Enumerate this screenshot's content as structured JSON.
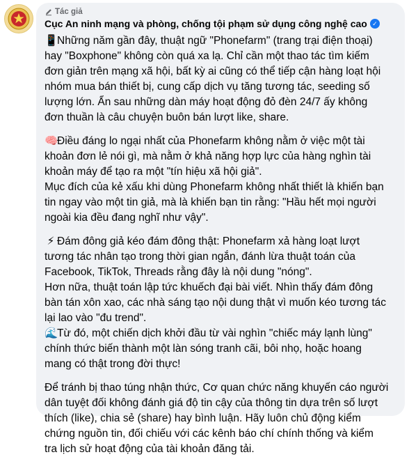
{
  "author_tag": "Tác giả",
  "author_name": "Cục An ninh mạng và phòng, chống tội phạm sử dụng công nghệ cao",
  "paragraphs": [
    {
      "emoji": "📱",
      "text": "Những năm gần đây, thuật ngữ \"Phonefarm\" (trang trại điện thoại)\nhay \"Boxphone\" không còn quá xa lạ. Chỉ cần một thao tác tìm kiếm\nđơn giản trên mạng xã hội, bất kỳ ai cũng có thể tiếp cận hàng loạt hội\nnhóm mua bán thiết bị, cung cấp dịch vụ tăng tương tác, seeding số\nlượng lớn. Ẩn sau những dàn máy hoạt động đỏ đèn 24/7 ấy không\nđơn thuần là câu chuyện buôn bán lượt like, share."
    },
    {
      "emoji": "🧠",
      "text": "Điều đáng lo ngại nhất của Phonefarm không nằm ở việc một tài\nkhoản đơn lẻ nói gì, mà nằm ở khả năng hợp lực của hàng nghìn tài\nkhoản máy để tạo ra một \"tín hiệu xã hội giả\".\nMục đích của kẻ xấu khi dùng Phonefarm không nhất thiết là khiến bạn\ntin ngay vào một tin giả, mà là khiến bạn tin rằng: \"Hầu hết mọi người\nngoài kia đều đang nghĩ như vậy\"."
    },
    {
      "emoji": "⚡",
      "text": "Đám đông giả kéo đám đông thật: Phonefarm xả hàng loạt lượt\ntương tác nhân tạo trong thời gian ngắn, đánh lừa thuật toán của\nFacebook, TikTok, Threads rằng đây là nội dung \"nóng\".\nHơn nữa, thuật toán lập tức khuếch đại bài viết. Nhìn thấy đám đông\nbàn tán xôn xao, các nhà sáng tạo nội dung thật vì muốn kéo tương tác\nlại lao vào \"đu trend\"."
    },
    {
      "emoji": "🌊",
      "text": "Từ đó, một chiến dịch khởi đầu từ vài nghìn \"chiếc máy lạnh lùng\"\nchính thức biến thành một làn sóng tranh cãi, bôi nhọ, hoặc hoang\nmang có thật trong đời thực!"
    },
    {
      "emoji": "",
      "text": "Để tránh bị thao túng nhận thức, Cơ quan chức năng khuyến cáo người\ndân tuyệt đối không đánh giá độ tin cậy của thông tin dựa trên số lượt\nthích (like), chia sẻ (share) hay bình luận. Hãy luôn chủ động kiểm\nchứng nguồn tin, đối chiếu với các kênh báo chí chính thống và kiểm\ntra lịch sử hoạt động của tài khoản đăng tải."
    }
  ]
}
